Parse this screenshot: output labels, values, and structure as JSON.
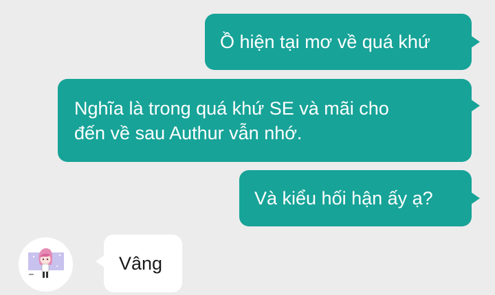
{
  "messages": [
    {
      "side": "sent",
      "text": "Ồ hiện tại mơ về quá khứ"
    },
    {
      "side": "sent",
      "lines": [
        "Nghĩa là trong quá khứ SE và mãi cho",
        "đến về sau Authur vẫn nhớ."
      ]
    },
    {
      "side": "sent",
      "text": "Và kiểu hối hận ấy ạ?"
    },
    {
      "side": "received",
      "text": "Vâng"
    }
  ],
  "colors": {
    "background": "#ececec",
    "sent_bubble": "#17a398",
    "received_bubble": "#ffffff"
  },
  "avatar": {
    "icon": "anime-character-avatar-icon"
  }
}
